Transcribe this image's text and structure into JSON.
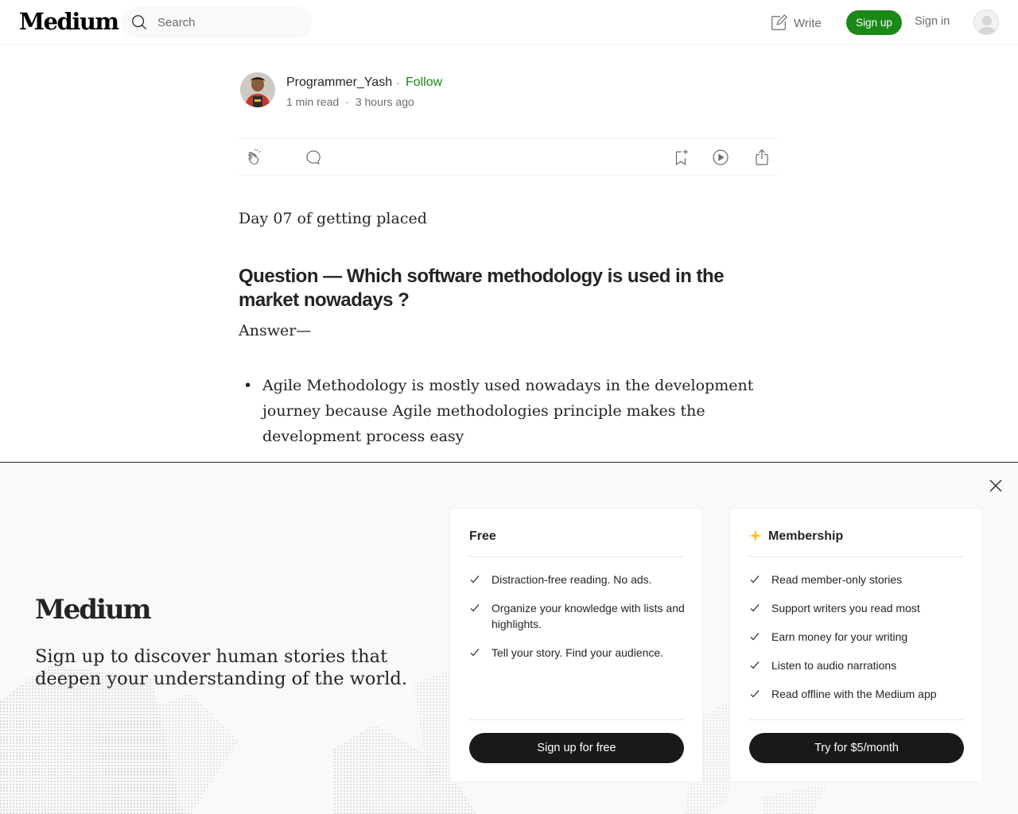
{
  "header": {
    "logo": "Medium",
    "search_placeholder": "Search",
    "write_label": "Write",
    "signup_label": "Sign up",
    "signin_label": "Sign in"
  },
  "author": {
    "name": "Programmer_Yash",
    "separator": "·",
    "follow_label": "Follow",
    "read_time": "1 min read",
    "meta_separator": "·",
    "published": "3 hours ago"
  },
  "action_bar": {
    "icons": [
      "clap-icon",
      "comment-icon",
      "bookmark-add-icon",
      "play-icon",
      "share-icon"
    ]
  },
  "article": {
    "intro": "Day 07 of getting placed",
    "heading": "Question — Which software methodology is used in the market nowadays ?",
    "answer_label": "Answer—",
    "list": [
      "Agile Methodology is mostly used nowadays in the development journey because Agile methodologies principle makes the development process easy"
    ]
  },
  "overlay": {
    "logo": "Medium",
    "tagline": "Sign up to discover human stories that deepen your understanding of the world.",
    "free_card": {
      "title": "Free",
      "features": [
        "Distraction-free reading. No ads.",
        "Organize your knowledge with lists and highlights.",
        "Tell your story. Find your audience."
      ],
      "button_label": "Sign up for free"
    },
    "member_card": {
      "title": "Membership",
      "features": [
        "Read member-only stories",
        "Support writers you read most",
        "Earn money for your writing",
        "Listen to audio narrations",
        "Read offline with the Medium app"
      ],
      "button_label": "Try for $5/month"
    }
  },
  "colors": {
    "brand_green": "#1a8917",
    "text": "#242424",
    "muted": "#6b6b6b",
    "button_dark": "#191919",
    "star": "#ffc017"
  }
}
